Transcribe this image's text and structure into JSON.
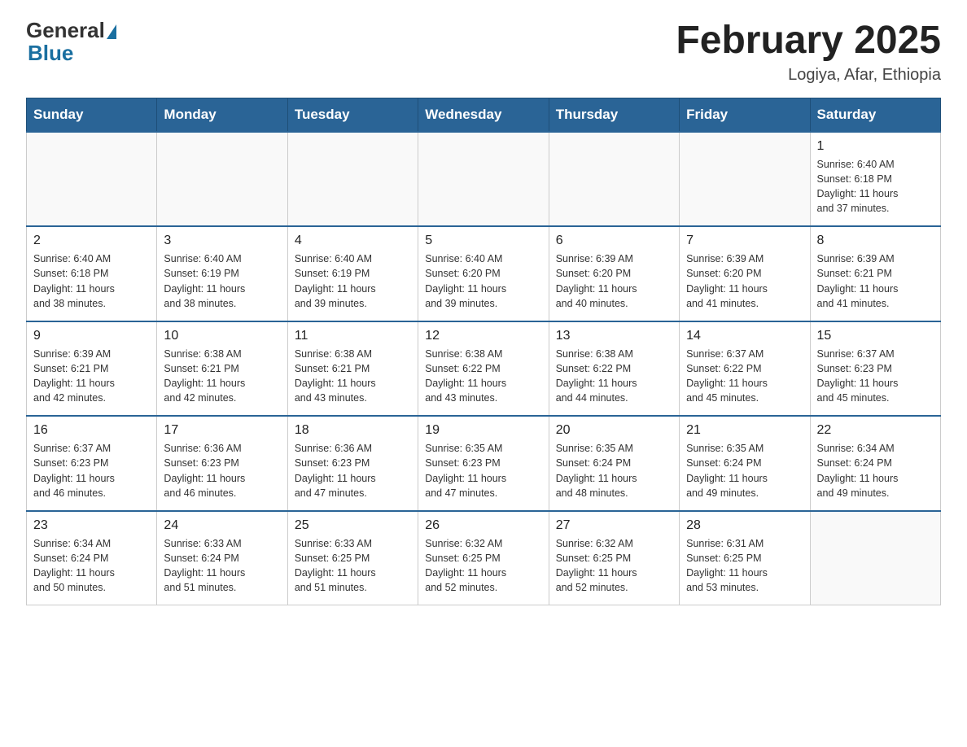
{
  "header": {
    "logo_general": "General",
    "logo_blue": "Blue",
    "month_title": "February 2025",
    "location": "Logiya, Afar, Ethiopia"
  },
  "weekdays": [
    "Sunday",
    "Monday",
    "Tuesday",
    "Wednesday",
    "Thursday",
    "Friday",
    "Saturday"
  ],
  "weeks": [
    [
      {
        "day": "",
        "info": ""
      },
      {
        "day": "",
        "info": ""
      },
      {
        "day": "",
        "info": ""
      },
      {
        "day": "",
        "info": ""
      },
      {
        "day": "",
        "info": ""
      },
      {
        "day": "",
        "info": ""
      },
      {
        "day": "1",
        "info": "Sunrise: 6:40 AM\nSunset: 6:18 PM\nDaylight: 11 hours\nand 37 minutes."
      }
    ],
    [
      {
        "day": "2",
        "info": "Sunrise: 6:40 AM\nSunset: 6:18 PM\nDaylight: 11 hours\nand 38 minutes."
      },
      {
        "day": "3",
        "info": "Sunrise: 6:40 AM\nSunset: 6:19 PM\nDaylight: 11 hours\nand 38 minutes."
      },
      {
        "day": "4",
        "info": "Sunrise: 6:40 AM\nSunset: 6:19 PM\nDaylight: 11 hours\nand 39 minutes."
      },
      {
        "day": "5",
        "info": "Sunrise: 6:40 AM\nSunset: 6:20 PM\nDaylight: 11 hours\nand 39 minutes."
      },
      {
        "day": "6",
        "info": "Sunrise: 6:39 AM\nSunset: 6:20 PM\nDaylight: 11 hours\nand 40 minutes."
      },
      {
        "day": "7",
        "info": "Sunrise: 6:39 AM\nSunset: 6:20 PM\nDaylight: 11 hours\nand 41 minutes."
      },
      {
        "day": "8",
        "info": "Sunrise: 6:39 AM\nSunset: 6:21 PM\nDaylight: 11 hours\nand 41 minutes."
      }
    ],
    [
      {
        "day": "9",
        "info": "Sunrise: 6:39 AM\nSunset: 6:21 PM\nDaylight: 11 hours\nand 42 minutes."
      },
      {
        "day": "10",
        "info": "Sunrise: 6:38 AM\nSunset: 6:21 PM\nDaylight: 11 hours\nand 42 minutes."
      },
      {
        "day": "11",
        "info": "Sunrise: 6:38 AM\nSunset: 6:21 PM\nDaylight: 11 hours\nand 43 minutes."
      },
      {
        "day": "12",
        "info": "Sunrise: 6:38 AM\nSunset: 6:22 PM\nDaylight: 11 hours\nand 43 minutes."
      },
      {
        "day": "13",
        "info": "Sunrise: 6:38 AM\nSunset: 6:22 PM\nDaylight: 11 hours\nand 44 minutes."
      },
      {
        "day": "14",
        "info": "Sunrise: 6:37 AM\nSunset: 6:22 PM\nDaylight: 11 hours\nand 45 minutes."
      },
      {
        "day": "15",
        "info": "Sunrise: 6:37 AM\nSunset: 6:23 PM\nDaylight: 11 hours\nand 45 minutes."
      }
    ],
    [
      {
        "day": "16",
        "info": "Sunrise: 6:37 AM\nSunset: 6:23 PM\nDaylight: 11 hours\nand 46 minutes."
      },
      {
        "day": "17",
        "info": "Sunrise: 6:36 AM\nSunset: 6:23 PM\nDaylight: 11 hours\nand 46 minutes."
      },
      {
        "day": "18",
        "info": "Sunrise: 6:36 AM\nSunset: 6:23 PM\nDaylight: 11 hours\nand 47 minutes."
      },
      {
        "day": "19",
        "info": "Sunrise: 6:35 AM\nSunset: 6:23 PM\nDaylight: 11 hours\nand 47 minutes."
      },
      {
        "day": "20",
        "info": "Sunrise: 6:35 AM\nSunset: 6:24 PM\nDaylight: 11 hours\nand 48 minutes."
      },
      {
        "day": "21",
        "info": "Sunrise: 6:35 AM\nSunset: 6:24 PM\nDaylight: 11 hours\nand 49 minutes."
      },
      {
        "day": "22",
        "info": "Sunrise: 6:34 AM\nSunset: 6:24 PM\nDaylight: 11 hours\nand 49 minutes."
      }
    ],
    [
      {
        "day": "23",
        "info": "Sunrise: 6:34 AM\nSunset: 6:24 PM\nDaylight: 11 hours\nand 50 minutes."
      },
      {
        "day": "24",
        "info": "Sunrise: 6:33 AM\nSunset: 6:24 PM\nDaylight: 11 hours\nand 51 minutes."
      },
      {
        "day": "25",
        "info": "Sunrise: 6:33 AM\nSunset: 6:25 PM\nDaylight: 11 hours\nand 51 minutes."
      },
      {
        "day": "26",
        "info": "Sunrise: 6:32 AM\nSunset: 6:25 PM\nDaylight: 11 hours\nand 52 minutes."
      },
      {
        "day": "27",
        "info": "Sunrise: 6:32 AM\nSunset: 6:25 PM\nDaylight: 11 hours\nand 52 minutes."
      },
      {
        "day": "28",
        "info": "Sunrise: 6:31 AM\nSunset: 6:25 PM\nDaylight: 11 hours\nand 53 minutes."
      },
      {
        "day": "",
        "info": ""
      }
    ]
  ]
}
